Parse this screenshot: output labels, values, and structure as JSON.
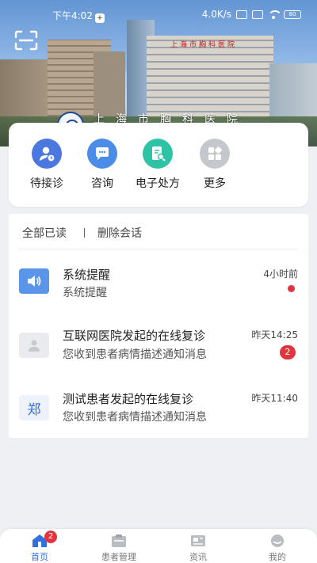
{
  "status_bar": {
    "time": "下午4:02",
    "network_speed": "4.0K/s",
    "battery": "80"
  },
  "hero": {
    "hospital_name": "上海市胸科医院",
    "building_sign": "上海市胸科医院"
  },
  "quick_actions": [
    {
      "label": "待接诊",
      "icon": "doctor-pending-icon",
      "color": "#4a78e0"
    },
    {
      "label": "咨询",
      "icon": "chat-bubble-icon",
      "color": "#4a8ce8"
    },
    {
      "label": "电子处方",
      "icon": "prescription-icon",
      "color": "#2fc3a6"
    },
    {
      "label": "更多",
      "icon": "more-grid-icon",
      "color": "#bfc3c8"
    }
  ],
  "messages_toolbar": {
    "mark_all_read": "全部已读",
    "delete_conversations": "删除会话"
  },
  "messages": [
    {
      "title": "系统提醒",
      "subtitle": "系统提醒",
      "time": "4小时前",
      "indicator": "dot",
      "avatar_icon": "speaker-icon"
    },
    {
      "title": "互联网医院发起的在线复诊",
      "subtitle": "您收到患者病情描述通知消息",
      "time": "昨天14:25",
      "indicator": "2",
      "avatar_icon": "person-icon"
    },
    {
      "title": "测试患者发起的在线复诊",
      "subtitle": "您收到患者病情描述通知消息",
      "time": "昨天11:40",
      "avatar_text": "郑",
      "avatar_icon": "name-avatar"
    }
  ],
  "bottom_nav": [
    {
      "label": "首页",
      "icon": "home-icon",
      "badge": "2",
      "active": true
    },
    {
      "label": "患者管理",
      "icon": "patient-management-icon"
    },
    {
      "label": "资讯",
      "icon": "news-icon"
    },
    {
      "label": "我的",
      "icon": "profile-icon"
    }
  ],
  "colors": {
    "accent": "#2f6fe0",
    "alert": "#e0353f",
    "background": "#eef0f3"
  }
}
